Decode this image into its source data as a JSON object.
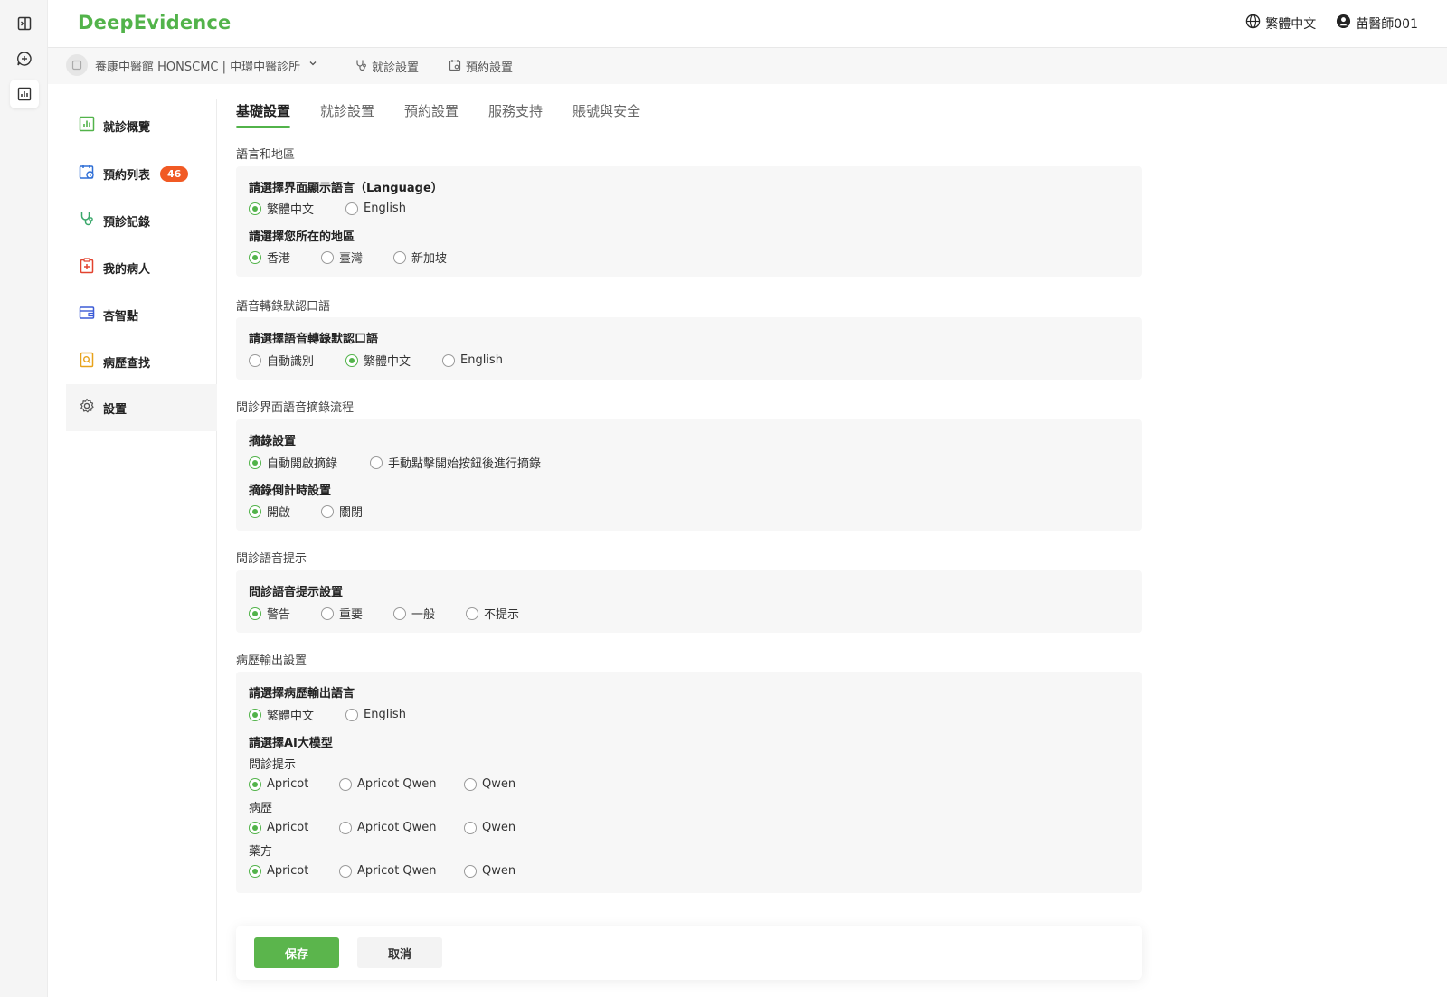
{
  "app": {
    "logo": "DeepEvidence"
  },
  "header": {
    "language": "繁體中文",
    "user": "苗醫師001"
  },
  "subbar": {
    "clinic": "養康中醫館 HONSCMC | 中環中醫診所",
    "link1": "就診設置",
    "link2": "預約設置"
  },
  "sidebar": {
    "items": [
      {
        "label": "就診概覽",
        "icon": "chart-icon"
      },
      {
        "label": "預約列表",
        "icon": "calendar-icon",
        "badge": "46"
      },
      {
        "label": "預診記錄",
        "icon": "stethoscope-icon"
      },
      {
        "label": "我的病人",
        "icon": "patient-icon"
      },
      {
        "label": "杏智點",
        "icon": "wallet-icon"
      },
      {
        "label": "病歷查找",
        "icon": "record-search-icon"
      },
      {
        "label": "設置",
        "icon": "gear-icon"
      }
    ]
  },
  "tabs": [
    "基礎設置",
    "就診設置",
    "預約設置",
    "服務支持",
    "賬號與安全"
  ],
  "sections": {
    "s1": {
      "title": "語言和地區",
      "q1": "請選擇界面顯示語言（Language）",
      "q1_opts": [
        "繁體中文",
        "English"
      ],
      "q2": "請選擇您所在的地區",
      "q2_opts": [
        "香港",
        "臺灣",
        "新加坡"
      ]
    },
    "s2": {
      "title": "語音轉錄默認口語",
      "q1": "請選擇語音轉錄默認口語",
      "q1_opts": [
        "自動識別",
        "繁體中文",
        "English"
      ]
    },
    "s3": {
      "title": "問診界面語音摘錄流程",
      "q1": "摘錄設置",
      "q1_opts": [
        "自動開啟摘錄",
        "手動點擊開始按鈕後進行摘錄"
      ],
      "q2": "摘錄倒計時設置",
      "q2_opts": [
        "開啟",
        "關閉"
      ]
    },
    "s4": {
      "title": "問診語音提示",
      "q1": "問診語音提示設置",
      "q1_opts": [
        "警告",
        "重要",
        "一般",
        "不提示"
      ]
    },
    "s5": {
      "title": "病歷輸出設置",
      "q1": "請選擇病歷輸出語言",
      "q1_opts": [
        "繁體中文",
        "English"
      ],
      "q2": "請選擇AI大模型",
      "sub1": "問診提示",
      "sub2": "病歷",
      "sub3": "藥方",
      "model_opts": [
        "Apricot",
        "Apricot Qwen",
        "Qwen"
      ]
    }
  },
  "footer": {
    "save": "保存",
    "cancel": "取消"
  },
  "colors": {
    "accent": "#52b34a",
    "badge": "#f15a24"
  }
}
